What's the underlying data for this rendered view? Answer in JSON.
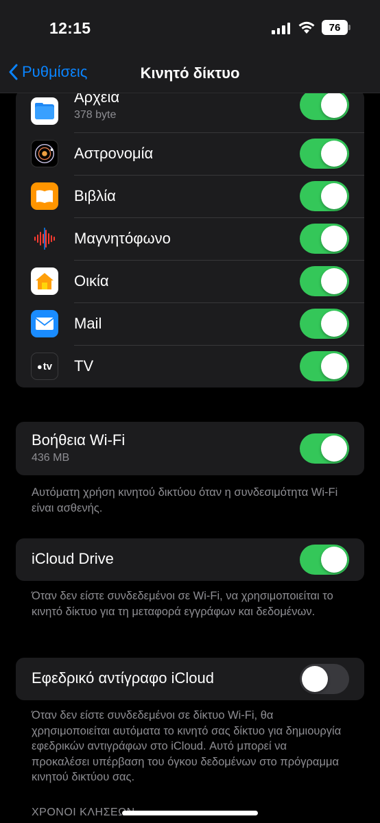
{
  "status_bar": {
    "time": "12:15",
    "battery": "76"
  },
  "nav": {
    "back_label": "Ρυθμίσεις",
    "title": "Κινητό δίκτυο"
  },
  "apps": [
    {
      "name": "Αρχεία",
      "detail": "378 byte",
      "icon": "files-icon",
      "enabled": true
    },
    {
      "name": "Αστρονομία",
      "detail": "",
      "icon": "astronomy-icon",
      "enabled": true
    },
    {
      "name": "Βιβλία",
      "detail": "",
      "icon": "books-icon",
      "enabled": true
    },
    {
      "name": "Μαγνητόφωνο",
      "detail": "",
      "icon": "voice-memos-icon",
      "enabled": true
    },
    {
      "name": "Οικία",
      "detail": "",
      "icon": "home-icon",
      "enabled": true
    },
    {
      "name": "Mail",
      "detail": "",
      "icon": "mail-icon",
      "enabled": true
    },
    {
      "name": "TV",
      "detail": "",
      "icon": "tv-icon",
      "enabled": true
    }
  ],
  "tv_icon_text": "tv",
  "wifi_assist": {
    "label": "Βοήθεια Wi-Fi",
    "detail": "436 MB",
    "enabled": true,
    "footer": "Αυτόματη χρήση κινητού δικτύου όταν η συνδεσιμότητα Wi-Fi είναι ασθενής."
  },
  "icloud_drive": {
    "label": "iCloud Drive",
    "enabled": true,
    "footer": "Όταν δεν είστε συνδεδεμένοι σε Wi-Fi, να χρησιμοποιείται το κινητό δίκτυο για τη μεταφορά εγγράφων και δεδομένων."
  },
  "icloud_backup": {
    "label": "Εφεδρικό αντίγραφο iCloud",
    "enabled": false,
    "footer": "Όταν δεν είστε συνδεδεμένοι σε δίκτυο Wi-Fi, θα χρησιμοποιείται αυτόματα το κινητό σας δίκτυο για δημιουργία εφεδρικών αντιγράφων στο iCloud. Αυτό μπορεί να προκαλέσει υπέρβαση του όγκου δεδομένων στο πρόγραμμα κινητού δικτύου σας."
  },
  "calls_section_title": "ΧΡΟΝΟΙ ΚΛΗΣΕΩΝ",
  "colors": {
    "accent": "#0a84ff",
    "toggle_on": "#34c759",
    "toggle_off": "#39393d",
    "background": "#000000",
    "cell": "#1c1c1e"
  }
}
